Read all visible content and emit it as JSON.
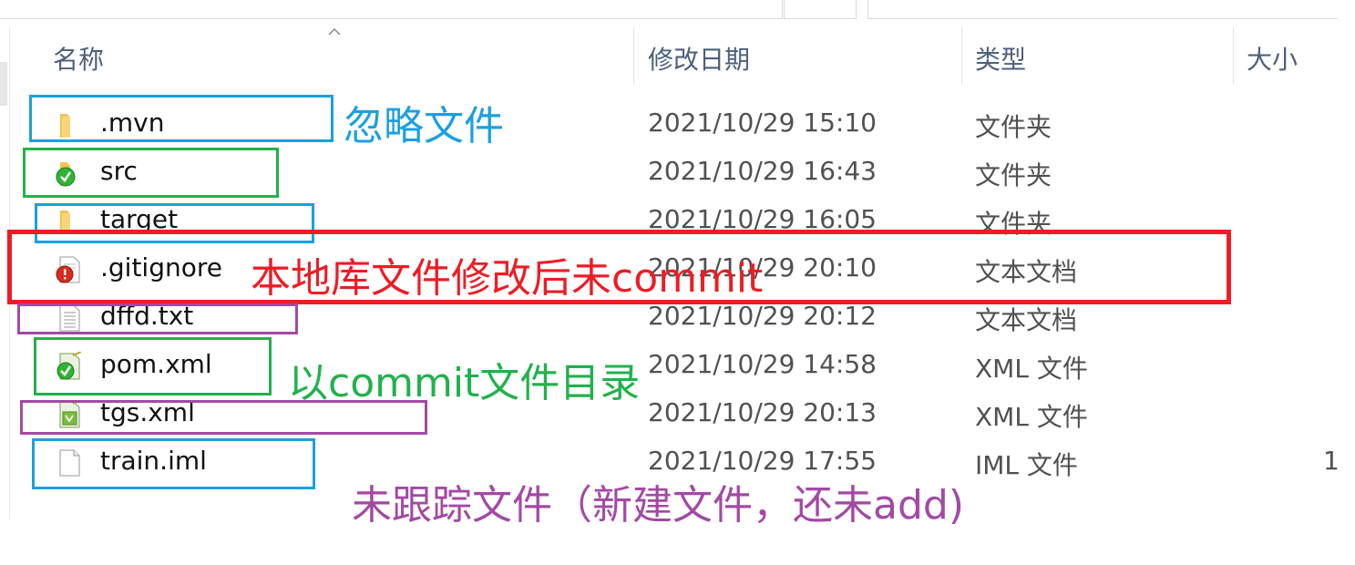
{
  "header": {
    "name": "名称",
    "date_modified": "修改日期",
    "type": "类型",
    "size": "大小"
  },
  "files": [
    {
      "name": ".mvn",
      "date": "2021/10/29 15:10",
      "type": "文件夹",
      "size": "",
      "icon": "folder-icon"
    },
    {
      "name": "src",
      "date": "2021/10/29 16:43",
      "type": "文件夹",
      "size": "",
      "icon": "folder-committed-icon"
    },
    {
      "name": "target",
      "date": "2021/10/29 16:05",
      "type": "文件夹",
      "size": "",
      "icon": "folder-icon"
    },
    {
      "name": ".gitignore",
      "date": "2021/10/29 20:10",
      "type": "文本文档",
      "size": "",
      "icon": "modified-file-icon"
    },
    {
      "name": "dffd.txt",
      "date": "2021/10/29 20:12",
      "type": "文本文档",
      "size": "",
      "icon": "text-file-icon"
    },
    {
      "name": "pom.xml",
      "date": "2021/10/29 14:58",
      "type": "XML 文件",
      "size": "",
      "icon": "xml-committed-icon"
    },
    {
      "name": "tgs.xml",
      "date": "2021/10/29 20:13",
      "type": "XML 文件",
      "size": "",
      "icon": "xml-file-icon"
    },
    {
      "name": "train.iml",
      "date": "2021/10/29 17:55",
      "type": "IML 文件",
      "size": "1",
      "icon": "blank-file-icon"
    }
  ],
  "annotations": {
    "ignored": "忽略文件",
    "modified": "本地库文件修改后未commit",
    "committed": "以commit文件目录",
    "untracked": "未跟踪文件（新建文件，还未add)"
  },
  "colors": {
    "ignored": "#1aa0e0",
    "committed": "#22b14c",
    "modified": "#ee1c25",
    "untracked": "#a349a4",
    "header_text": "#4c607a"
  }
}
